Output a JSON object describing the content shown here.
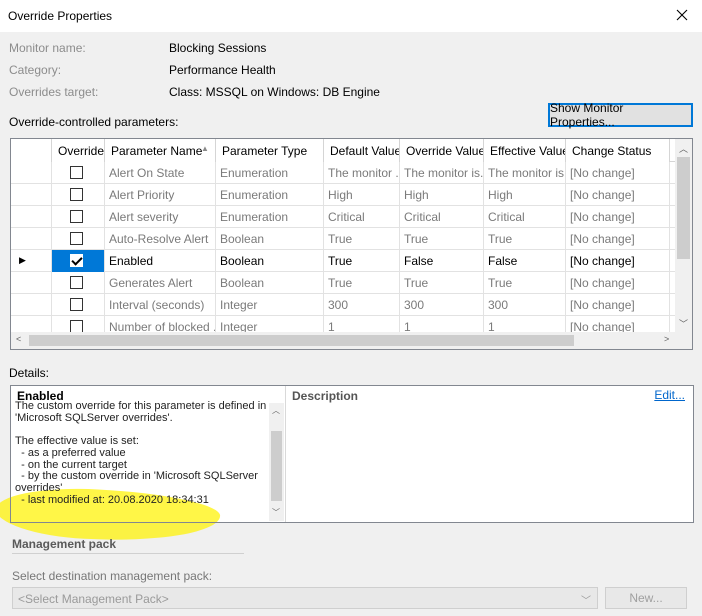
{
  "window": {
    "title": "Override Properties"
  },
  "info": [
    {
      "label": "Monitor name:",
      "value": "Blocking Sessions"
    },
    {
      "label": "Category:",
      "value": "Performance Health"
    },
    {
      "label": "Overrides target:",
      "value": "Class: MSSQL on Windows: DB Engine"
    }
  ],
  "show_monitor_button": "Show Monitor Properties...",
  "params_label": "Override-controlled parameters:",
  "grid": {
    "columns": [
      "Override",
      "Parameter Name",
      "Parameter Type",
      "Default Value",
      "Override Value",
      "Effective Value",
      "Change Status"
    ],
    "rows": [
      {
        "override": false,
        "name": "Alert On State",
        "type": "Enumeration",
        "default": "The monitor ...",
        "override_value": "The monitor is...",
        "effective": "The monitor is...",
        "status": "[No change]"
      },
      {
        "override": false,
        "name": "Alert Priority",
        "type": "Enumeration",
        "default": "High",
        "override_value": "High",
        "effective": "High",
        "status": "[No change]"
      },
      {
        "override": false,
        "name": "Alert severity",
        "type": "Enumeration",
        "default": "Critical",
        "override_value": "Critical",
        "effective": "Critical",
        "status": "[No change]"
      },
      {
        "override": false,
        "name": "Auto-Resolve Alert",
        "type": "Boolean",
        "default": "True",
        "override_value": "True",
        "effective": "True",
        "status": "[No change]"
      },
      {
        "override": true,
        "name": "Enabled",
        "type": "Boolean",
        "default": "True",
        "override_value": "False",
        "effective": "False",
        "status": "[No change]"
      },
      {
        "override": false,
        "name": "Generates Alert",
        "type": "Boolean",
        "default": "True",
        "override_value": "True",
        "effective": "True",
        "status": "[No change]"
      },
      {
        "override": false,
        "name": "Interval (seconds)",
        "type": "Integer",
        "default": "300",
        "override_value": "300",
        "effective": "300",
        "status": "[No change]"
      },
      {
        "override": false,
        "name": "Number of blocked ...",
        "type": "Integer",
        "default": "1",
        "override_value": "1",
        "effective": "1",
        "status": "[No change]"
      }
    ]
  },
  "details": {
    "label": "Details:",
    "title": "Enabled",
    "description_header": "Description",
    "edit_link": "Edit...",
    "lines": [
      "The custom override for this parameter is defined in",
      "'Microsoft SQLServer overrides'.",
      "",
      "The effective value is set:",
      "  - as a preferred value",
      "  - on the current target",
      "  - by the custom override in 'Microsoft SQLServer",
      "overrides'",
      "  - last modified at: 20.08.2020 18:34:31"
    ]
  },
  "management_pack": {
    "header": "Management pack",
    "select_label": "Select destination management pack:",
    "select_value": "<Select Management Pack>",
    "new_button": "New..."
  }
}
